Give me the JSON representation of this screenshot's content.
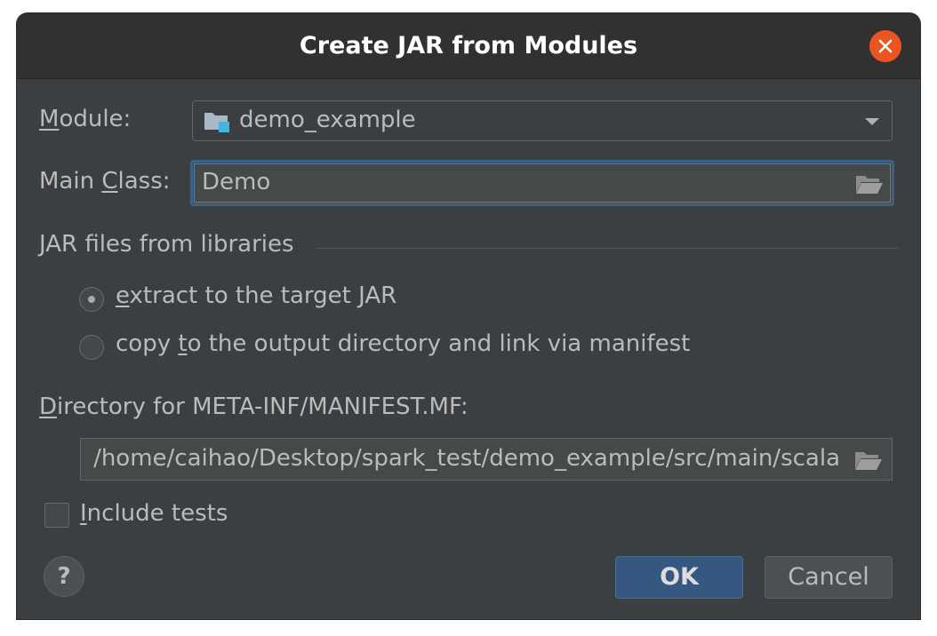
{
  "window": {
    "title": "Create JAR from Modules"
  },
  "module": {
    "label_prefix": "",
    "label_mnemonic": "M",
    "label_rest": "odule:",
    "value": "demo_example"
  },
  "main_class": {
    "label_prefix": "Main ",
    "label_mnemonic": "C",
    "label_rest": "lass:",
    "value": "Demo"
  },
  "libraries": {
    "group_title": "JAR files from libraries",
    "options": [
      {
        "prefix": "",
        "mnemonic": "e",
        "rest": "xtract to the target JAR",
        "selected": true
      },
      {
        "prefix": "copy ",
        "mnemonic": "t",
        "rest": "o the output directory and link via manifest",
        "selected": false
      }
    ]
  },
  "manifest": {
    "label_prefix": "",
    "label_mnemonic": "D",
    "label_rest": "irectory for META-INF/MANIFEST.MF:",
    "value": "/home/caihao/Desktop/spark_test/demo_example/src/main/scala"
  },
  "include_tests": {
    "prefix": "",
    "mnemonic": "I",
    "rest": "nclude tests",
    "checked": false
  },
  "buttons": {
    "help": "?",
    "ok": "OK",
    "cancel": "Cancel"
  },
  "icons": {
    "close": "close-icon",
    "module": "module-folder-icon",
    "browse": "folder-open-icon",
    "dropdown": "chevron-down-icon"
  },
  "colors": {
    "accent": "#365880",
    "focus_border": "#3d6185",
    "close": "#e95420",
    "background": "#3c3f41"
  }
}
